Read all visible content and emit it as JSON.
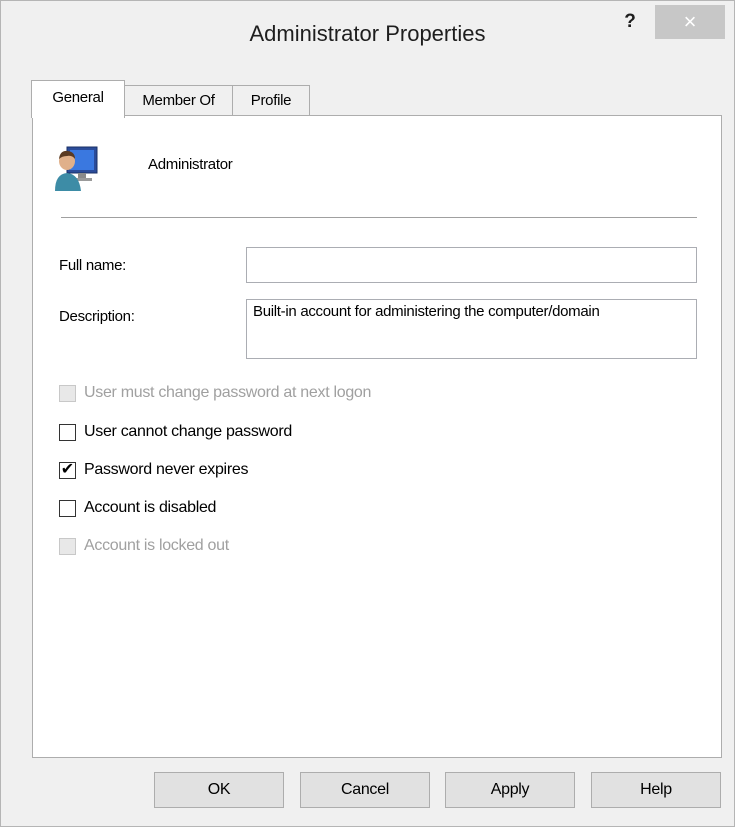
{
  "window": {
    "title": "Administrator Properties",
    "help_label": "?",
    "close_label": "×"
  },
  "tabs": [
    {
      "label": "General",
      "active": true
    },
    {
      "label": "Member Of",
      "active": false
    },
    {
      "label": "Profile",
      "active": false
    }
  ],
  "general": {
    "user_icon": "user-computer-icon",
    "username": "Administrator",
    "full_name": {
      "label": "Full name:",
      "value": ""
    },
    "description": {
      "label": "Description:",
      "value": "Built-in account for administering the computer/domain"
    },
    "checkboxes": [
      {
        "label": "User must change password at next logon",
        "checked": false,
        "enabled": false
      },
      {
        "label": "User cannot change password",
        "checked": false,
        "enabled": true
      },
      {
        "label": "Password never expires",
        "checked": true,
        "enabled": true
      },
      {
        "label": "Account is disabled",
        "checked": false,
        "enabled": true
      },
      {
        "label": "Account is locked out",
        "checked": false,
        "enabled": false
      }
    ]
  },
  "buttons": {
    "ok": "OK",
    "cancel": "Cancel",
    "apply": "Apply",
    "help": "Help"
  },
  "colors": {
    "window_bg": "#f0f0f0",
    "panel_bg": "#ffffff",
    "close_button_bg": "#c7c7c7",
    "disabled_text": "#a0a0a0"
  }
}
